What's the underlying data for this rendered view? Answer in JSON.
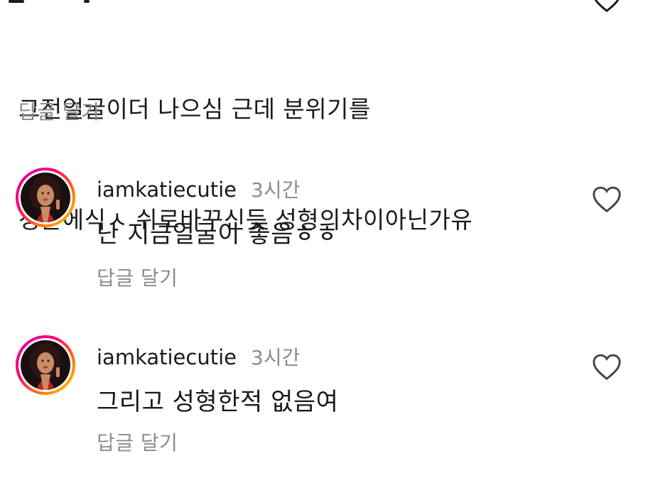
{
  "top_comment": {
    "line1": "그전얼굴이더 나으심 근데 분위기를",
    "line2": "청순에식ㅅ 쉬로바꾸신듯 성형의차이아닌가유",
    "reply": "답글 달기"
  },
  "replies": [
    {
      "username": "iamkatiecutie",
      "time": "3시간",
      "text": "난 지금얼굴이 좋음ㅎㅎ",
      "reply": "답글 달기"
    },
    {
      "username": "iamkatiecutie",
      "time": "3시간",
      "text": "그리고 성형한적 없음여",
      "reply": "답글 달기"
    }
  ],
  "icons": {
    "like": "heart-outline-icon",
    "avatar_ring": "instagram-story-gradient"
  }
}
